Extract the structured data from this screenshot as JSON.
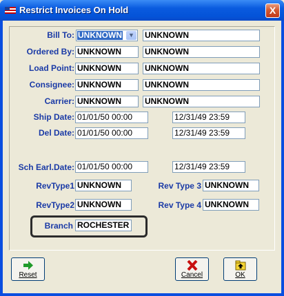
{
  "window": {
    "title": "Restrict Invoices On Hold",
    "close_glyph": "X"
  },
  "fields": {
    "bill_to": {
      "label": "Bill To:",
      "value1": "UNKNOWN",
      "value2": "UNKNOWN"
    },
    "ordered_by": {
      "label": "Ordered By:",
      "value1": "UNKNOWN",
      "value2": "UNKNOWN"
    },
    "load_point": {
      "label": "Load Point:",
      "value1": "UNKNOWN",
      "value2": "UNKNOWN"
    },
    "consignee": {
      "label": "Consignee:",
      "value1": "UNKNOWN",
      "value2": "UNKNOWN"
    },
    "carrier": {
      "label": "Carrier:",
      "value1": "UNKNOWN",
      "value2": "UNKNOWN"
    },
    "ship_date": {
      "label": "Ship Date:",
      "from": "01/01/50 00:00",
      "to": "12/31/49 23:59"
    },
    "del_date": {
      "label": "Del Date:",
      "from": "01/01/50 00:00",
      "to": "12/31/49 23:59"
    },
    "sch_earl_date": {
      "label": "Sch Earl.Date:",
      "from": "01/01/50 00:00",
      "to": "12/31/49 23:59"
    },
    "rev_type1": {
      "label": "RevType1",
      "value": "UNKNOWN"
    },
    "rev_type2": {
      "label": "RevType2",
      "value": "UNKNOWN"
    },
    "rev_type3": {
      "label": "Rev Type 3",
      "value": "UNKNOWN"
    },
    "rev_type4": {
      "label": "Rev Type 4",
      "value": "UNKNOWN"
    },
    "branch": {
      "label": "Branch",
      "value": "ROCHESTER"
    }
  },
  "buttons": {
    "reset": "Reset",
    "cancel": "Cancel",
    "ok": "OK"
  },
  "icons": {
    "reset": "green-arrow-icon",
    "cancel": "red-x-icon",
    "ok": "yellow-folder-up-icon"
  }
}
